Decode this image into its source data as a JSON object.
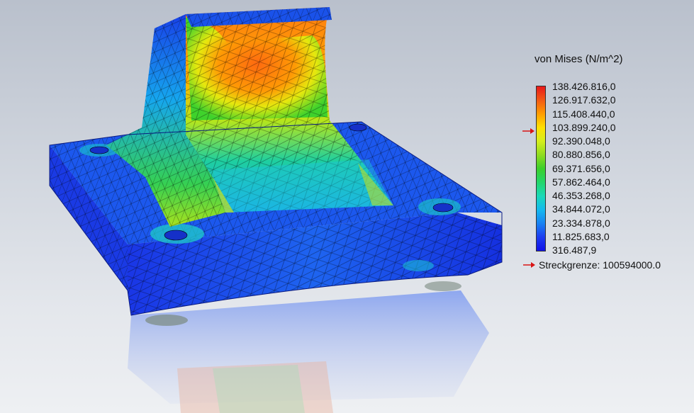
{
  "legend": {
    "title": "von Mises (N/m^2)",
    "labels": [
      "138.426.816,0",
      "126.917.632,0",
      "115.408.440,0",
      "103.899.240,0",
      "92.390.048,0",
      "80.880.856,0",
      "69.371.656,0",
      "57.862.464,0",
      "46.353.268,0",
      "34.844.072,0",
      "23.334.878,0",
      "11.825.683,0",
      "316.487,9"
    ],
    "colors": [
      "#e8181a",
      "#f25a14",
      "#ff9d00",
      "#ffe000",
      "#d5ee1c",
      "#8fdc20",
      "#3ccf2a",
      "#22d66a",
      "#1ad9b8",
      "#14b9ee",
      "#1882f2",
      "#1c3cf0",
      "#1010e8"
    ],
    "yield_marker_label_index": 3
  },
  "yield_strength": {
    "label": "Streckgrenze: 100594000.0"
  },
  "marker_color": "#d81414",
  "model": {
    "description_icon": "fea-stress-plot-3d-model"
  }
}
